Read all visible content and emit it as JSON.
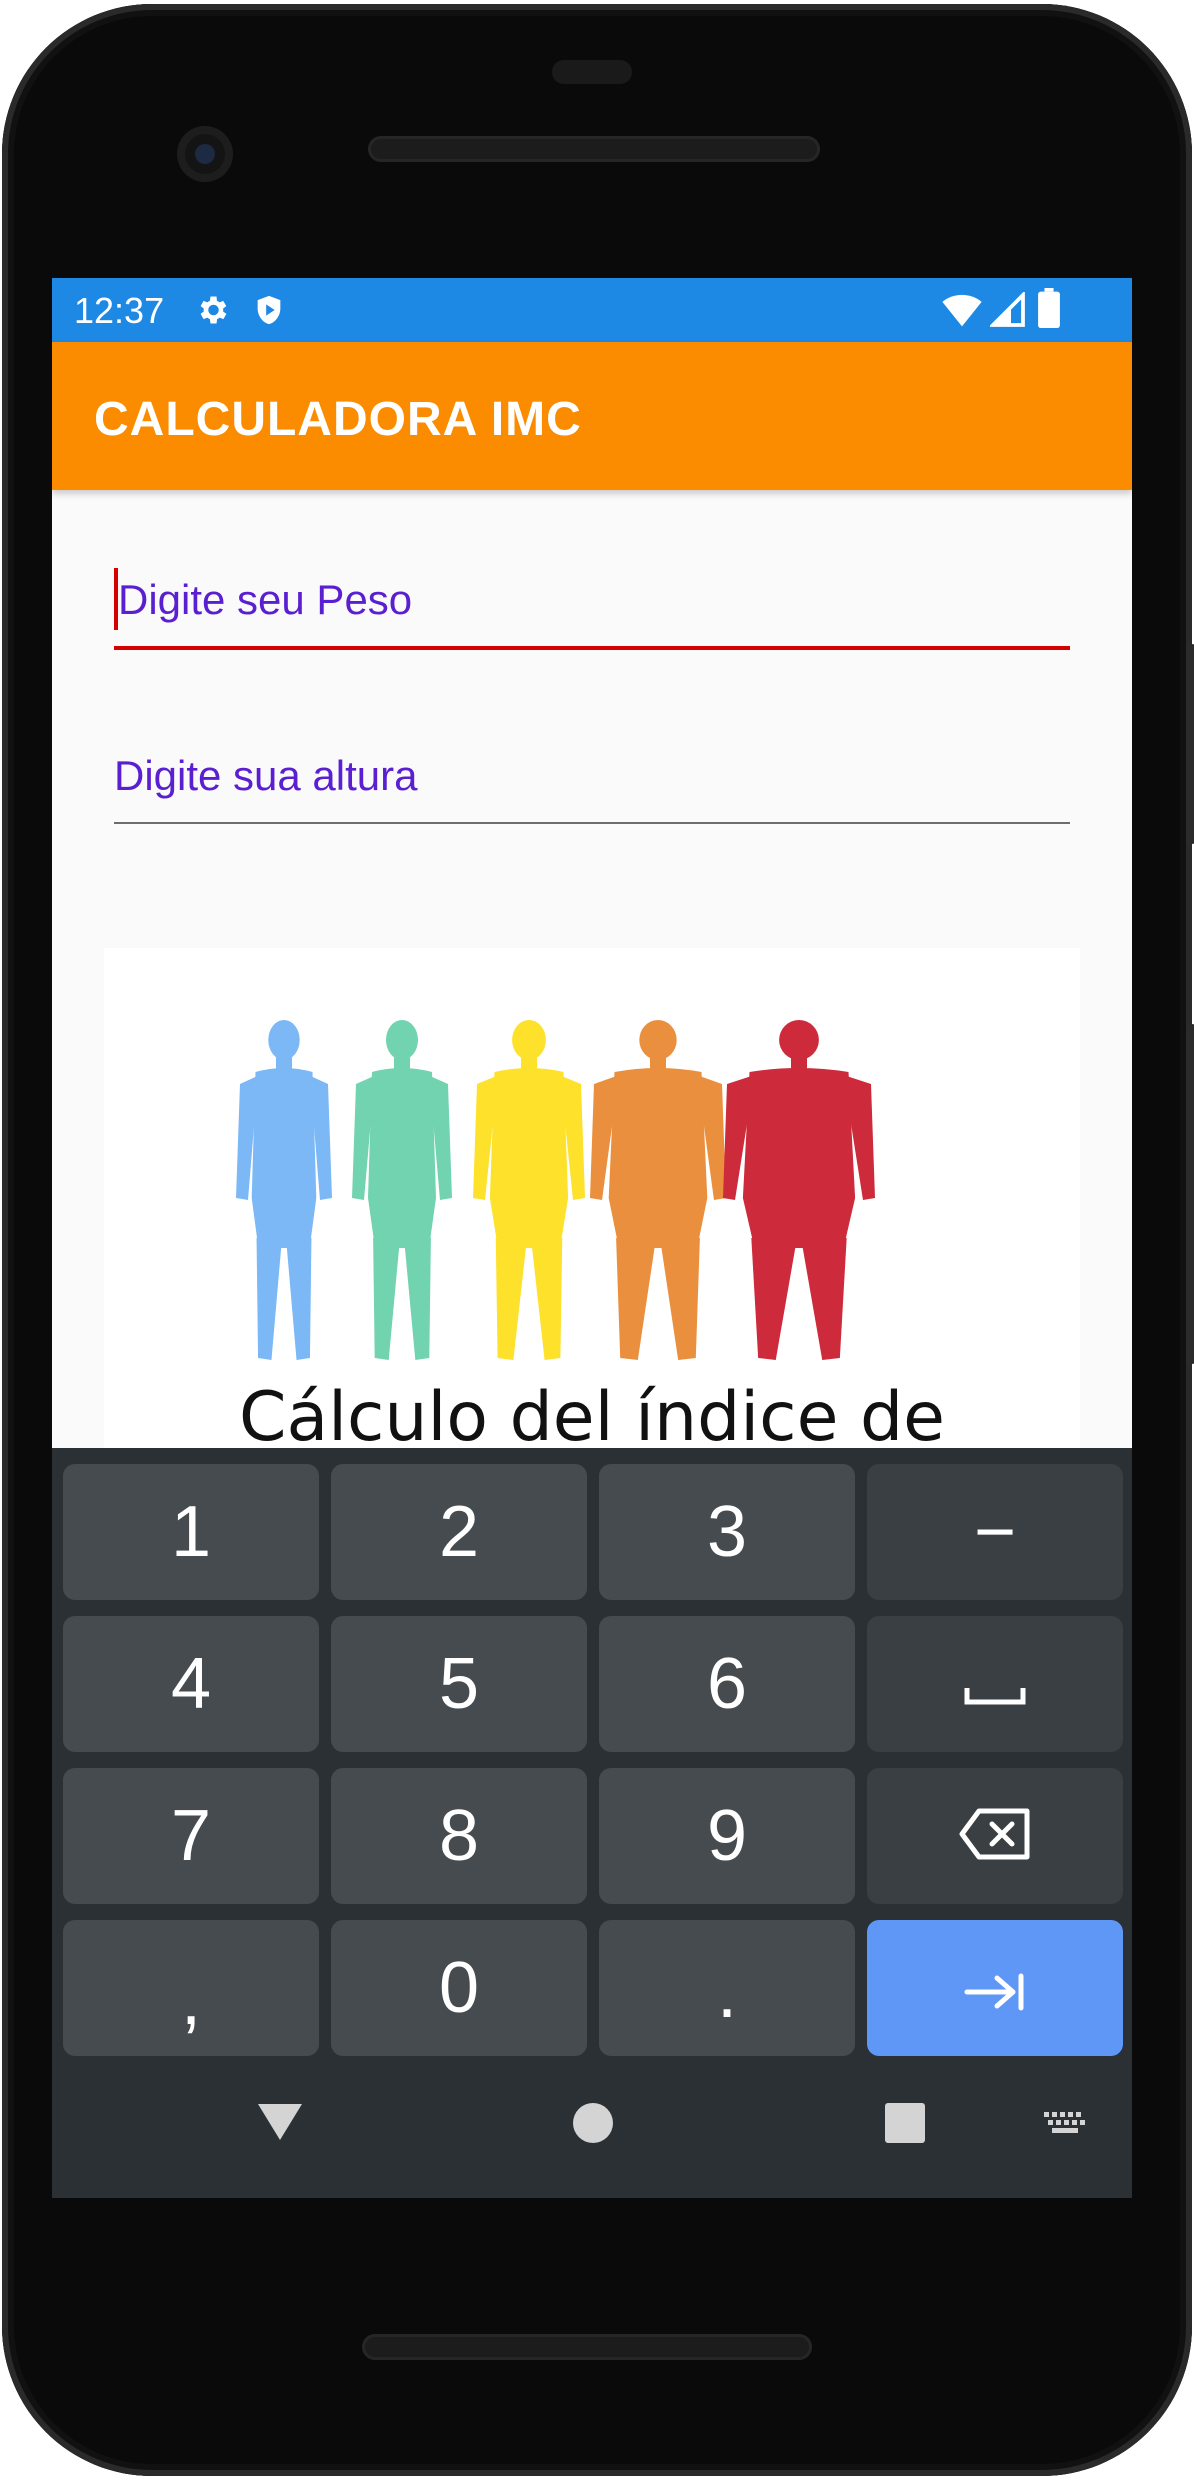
{
  "status_bar": {
    "time": "12:37",
    "icons_left": [
      "gear-icon",
      "shield-icon"
    ],
    "icons_right": [
      "wifi-icon",
      "signal-icon",
      "battery-icon"
    ]
  },
  "app_bar": {
    "title": "CALCULADORA IMC"
  },
  "form": {
    "weight_placeholder": "Digite seu Peso",
    "height_placeholder": "Digite sua altura"
  },
  "image": {
    "caption": "Cálculo del índice de",
    "figures": [
      {
        "color": "#7bb8f5"
      },
      {
        "color": "#72d3b0"
      },
      {
        "color": "#fde12b"
      },
      {
        "color": "#ea8f3e"
      },
      {
        "color": "#cd2a3b"
      }
    ]
  },
  "keyboard": {
    "keys": [
      "1",
      "2",
      "3",
      "−",
      "4",
      "5",
      "6",
      "␣",
      "7",
      "8",
      "9",
      "backspace-icon",
      ",",
      "0",
      ".",
      "next-icon"
    ]
  },
  "colors": {
    "status_bar": "#1e88e5",
    "app_bar": "#fb8c00",
    "hint_text": "#5a1fd0",
    "focused_underline": "#d50000",
    "action_key": "#5e97f6"
  }
}
